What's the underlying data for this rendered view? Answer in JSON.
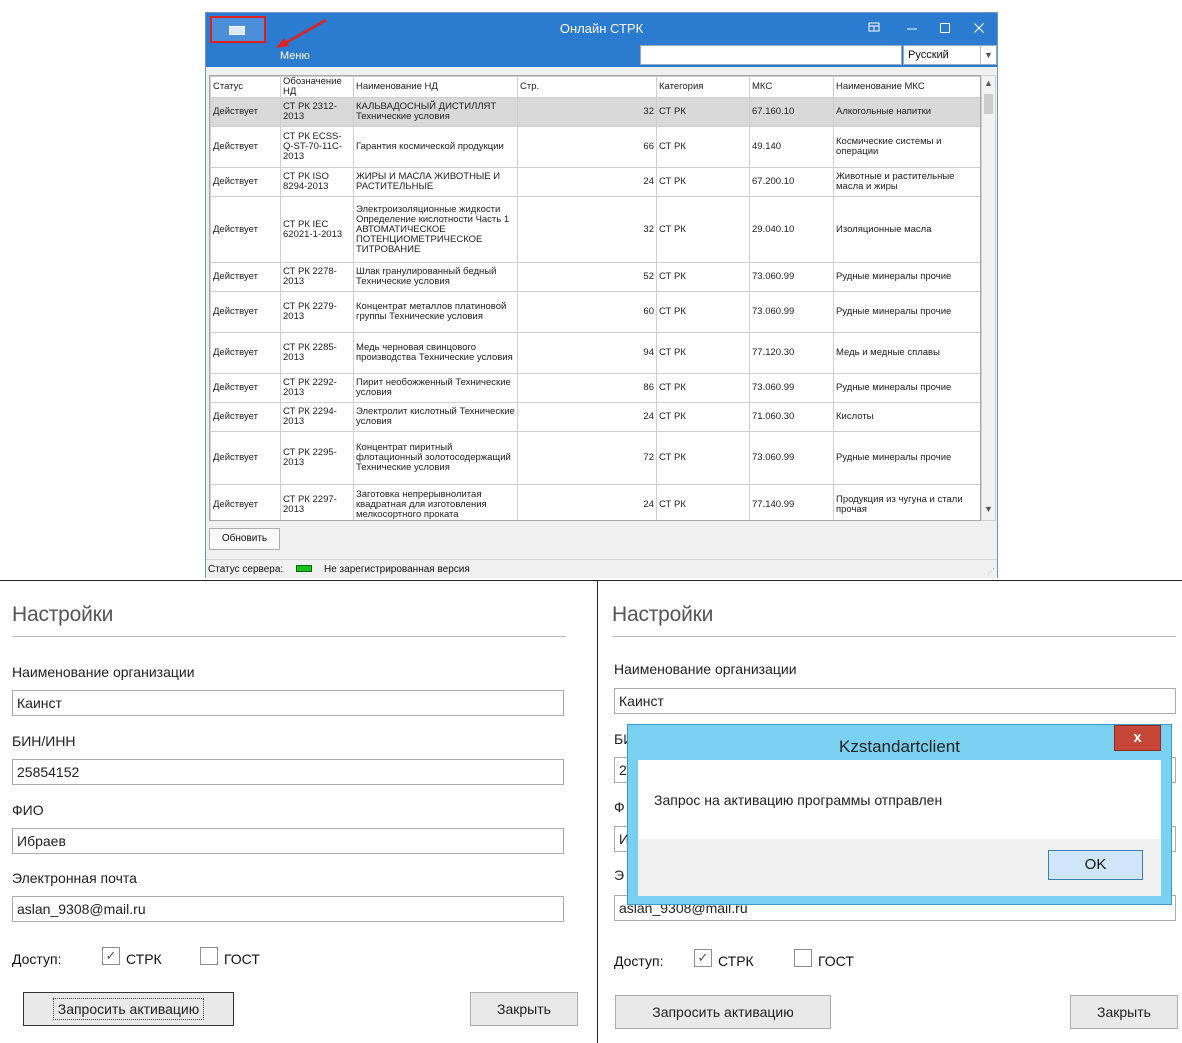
{
  "window": {
    "title": "Онлайн СТРК",
    "menu_label": "Меню",
    "search_placeholder": "",
    "language": "Русский",
    "columns": [
      "Статус",
      "Обозначение НД",
      "Наименование НД",
      "Стр.",
      "Категория",
      "МКС",
      "Наименование МКС"
    ],
    "rows": [
      {
        "status": "Действует",
        "code": "СТ РК 2312-2013",
        "name": " КАЛЬВАДОСНЫЙ ДИСТИЛЛЯТ Технические условия",
        "pages": "32",
        "category": "СТ РК",
        "mks": "67.160.10",
        "mks_name": "Алкогольные напитки"
      },
      {
        "status": "Действует",
        "code": "СТ РК ECSS-Q-ST-70-11C-2013",
        "name": "Гарантия космической продукции",
        "pages": "66",
        "category": "СТ РК",
        "mks": "49.140",
        "mks_name": "Космические системы и операции"
      },
      {
        "status": "Действует",
        "code": "СТ РК ISO 8294-2013",
        "name": "ЖИРЫ И МАСЛА ЖИВОТНЫЕ И РАСТИТЕЛЬНЫЕ",
        "pages": "24",
        "category": "СТ РК",
        "mks": "67.200.10",
        "mks_name": "Животные и растительные масла и жиры"
      },
      {
        "status": "Действует",
        "code": "СТ РК IEC 62021-1-2013",
        "name": "Электроизоляционные жидкости Определение кислотности Часть 1 АВТОМАТИЧЕСКОЕ ПОТЕНЦИОМЕТРИЧЕСКОЕ ТИТРОВАНИЕ",
        "pages": "32",
        "category": "СТ РК",
        "mks": "29.040.10",
        "mks_name": "Изоляционные масла"
      },
      {
        "status": "Действует",
        "code": "СТ РК 2278-2013",
        "name": "Шлак гранулированный бедный Технические условия",
        "pages": "52",
        "category": "СТ РК",
        "mks": "73.060.99",
        "mks_name": "Рудные минералы прочие"
      },
      {
        "status": "Действует",
        "code": "СТ РК 2279-2013",
        "name": "Концентрат металлов платиновой группы Технические условия",
        "pages": "60",
        "category": "СТ РК",
        "mks": "73.060.99",
        "mks_name": "Рудные минералы прочие"
      },
      {
        "status": "Действует",
        "code": "СТ РК 2285-2013",
        "name": "Медь черновая свинцового производства Технические условия",
        "pages": "94",
        "category": "СТ РК",
        "mks": "77.120.30",
        "mks_name": "Медь и медные сплавы"
      },
      {
        "status": "Действует",
        "code": "СТ РК 2292-2013",
        "name": "Пирит необожженный Технические условия",
        "pages": "86",
        "category": "СТ РК",
        "mks": "73.060.99",
        "mks_name": "Рудные минералы прочие"
      },
      {
        "status": "Действует",
        "code": "СТ РК 2294-2013",
        "name": "Электролит кислотный Технические условия",
        "pages": "24",
        "category": "СТ РК",
        "mks": "71.060.30",
        "mks_name": "Кислоты"
      },
      {
        "status": "Действует",
        "code": "СТ РК 2295-2013",
        "name": "Концентрат пиритный флотационный золотосодержащий Технические условия",
        "pages": "72",
        "category": "СТ РК",
        "mks": "73.060.99",
        "mks_name": "Рудные минералы прочие"
      },
      {
        "status": "Действует",
        "code": "СТ РК 2297-2013",
        "name": "Заготовка непрерывнолитая квадратная для изготовления мелкосортного проката",
        "pages": "24",
        "category": "СТ РК",
        "mks": "77.140.99",
        "mks_name": "Продукция из чугуна и стали прочая"
      }
    ],
    "refresh_label": "Обновить",
    "server_status_label": "Статус сервера:",
    "server_status_text": "Не зарегистрированная версия"
  },
  "settings_left": {
    "title": "Настройки",
    "org_label": "Наименование организации",
    "org_value": "Каинст",
    "bin_label": "БИН/ИНН",
    "bin_value": "25854152",
    "fio_label": "ФИО",
    "fio_value": "Ибраев",
    "email_label": "Электронная почта",
    "email_value": "aslan_9308@mail.ru",
    "access_label": "Доступ:",
    "strk_label": "СТРК",
    "gost_label": "ГОСТ",
    "request_label": "Запросить активацию",
    "close_label": "Закрыть"
  },
  "settings_right": {
    "title": "Настройки",
    "org_label": "Наименование организации",
    "org_value": "Каинст",
    "bin_label_partial": "БИ",
    "bin_value_partial": "2",
    "fio_label_partial": "Ф",
    "fio_value_partial": "И",
    "email_label_partial": "Э",
    "email_value": "aslan_9308@mail.ru",
    "access_label": "Доступ:",
    "strk_label": "СТРК",
    "gost_label": "ГОСТ",
    "request_label": "Запросить активацию",
    "close_label": "Закрыть"
  },
  "message_box": {
    "title": "Kzstandartclient",
    "text": "Запрос на активацию программы отправлен",
    "ok_label": "OK",
    "close_glyph": "x"
  },
  "checkmark": "✓",
  "colors": {
    "titlebar": "#2b7bd0",
    "highlight": "#e02020",
    "msgbox_frame": "#7ad0f1",
    "close_button": "#c64637"
  }
}
